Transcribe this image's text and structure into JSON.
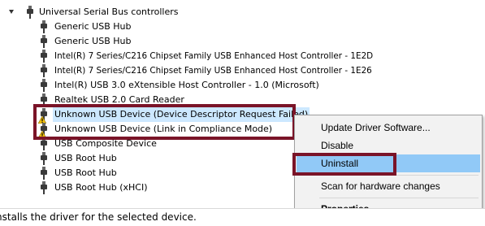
{
  "tree": {
    "category": {
      "label": "Universal Serial Bus controllers",
      "icon": "usb-plug-icon",
      "expanded": true
    },
    "devices": [
      {
        "label": "Generic USB Hub",
        "icon": "usb-plug-icon",
        "warning": false
      },
      {
        "label": "Generic USB Hub",
        "icon": "usb-plug-icon",
        "warning": false
      },
      {
        "label": "Intel(R) 7 Series/C216 Chipset Family USB Enhanced Host Controller - 1E2D",
        "icon": "usb-plug-icon",
        "warning": false
      },
      {
        "label": "Intel(R) 7 Series/C216 Chipset Family USB Enhanced Host Controller - 1E26",
        "icon": "usb-plug-icon",
        "warning": false
      },
      {
        "label": "Intel(R) USB 3.0 eXtensible Host Controller - 1.0 (Microsoft)",
        "icon": "usb-plug-icon",
        "warning": false
      },
      {
        "label": "Realtek USB 2.0 Card Reader",
        "icon": "usb-plug-icon",
        "warning": false
      },
      {
        "label": "Unknown USB Device (Device Descriptor Request Failed)",
        "icon": "usb-plug-icon",
        "warning": true,
        "selected": true
      },
      {
        "label": "Unknown USB Device (Link in Compliance Mode)",
        "icon": "usb-plug-icon",
        "warning": true
      },
      {
        "label": "USB Composite Device",
        "icon": "usb-plug-icon",
        "warning": false
      },
      {
        "label": "USB Root Hub",
        "icon": "usb-plug-icon",
        "warning": false
      },
      {
        "label": "USB Root Hub",
        "icon": "usb-plug-icon",
        "warning": false
      },
      {
        "label": "USB Root Hub (xHCI)",
        "icon": "usb-plug-icon",
        "warning": false
      }
    ]
  },
  "context_menu": {
    "items": [
      {
        "label": "Update Driver Software...",
        "active": false,
        "bold": false
      },
      {
        "label": "Disable",
        "active": false,
        "bold": false
      },
      {
        "label": "Uninstall",
        "active": true,
        "bold": false
      },
      {
        "label": "Scan for hardware changes",
        "active": false,
        "bold": false
      },
      {
        "label": "Properties",
        "active": false,
        "bold": true
      }
    ]
  },
  "status_bar": {
    "text": "nstalls the driver for the selected device."
  },
  "colors": {
    "annotation_box": "#7a1428",
    "menu_highlight": "#91c9f7",
    "selection": "#cce8ff",
    "warning": "#f4c20d"
  }
}
